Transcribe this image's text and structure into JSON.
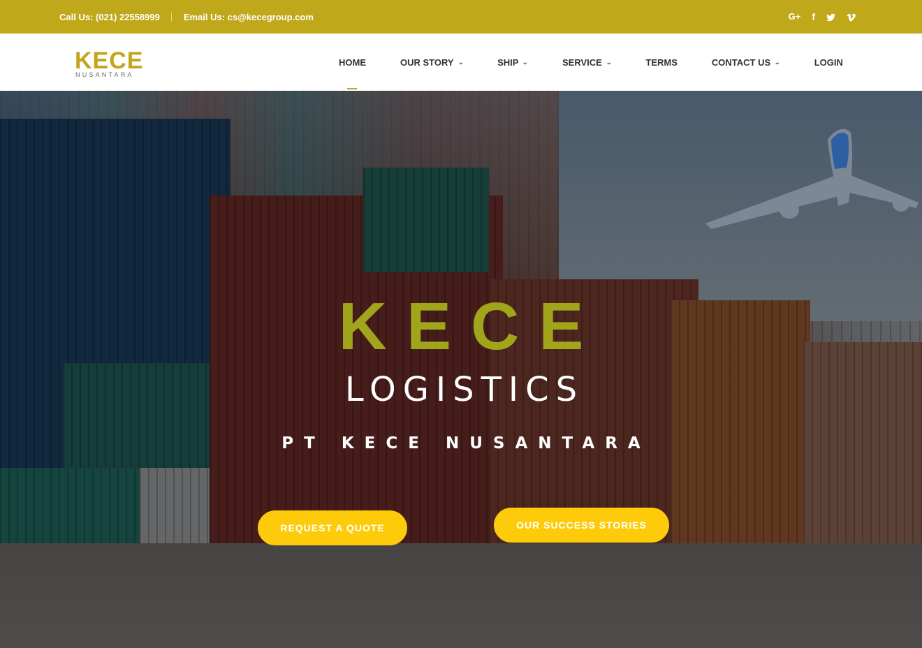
{
  "topbar": {
    "phone": "Call Us: (021) 22558999",
    "email": "Email Us: cs@kecegroup.com",
    "social": [
      {
        "icon": "google-plus-icon",
        "glyph": "G+"
      },
      {
        "icon": "facebook-icon",
        "glyph": "f"
      },
      {
        "icon": "twitter-icon",
        "glyph": "t"
      },
      {
        "icon": "vimeo-icon",
        "glyph": "v"
      }
    ]
  },
  "logo": {
    "main": "KECE",
    "sub": "NUSANTARA"
  },
  "nav": {
    "items": [
      {
        "label": "HOME",
        "active": true,
        "dropdown": false
      },
      {
        "label": "OUR STORY",
        "active": false,
        "dropdown": true
      },
      {
        "label": "SHIP",
        "active": false,
        "dropdown": true
      },
      {
        "label": "SERVICE",
        "active": false,
        "dropdown": true
      },
      {
        "label": "TERMS",
        "active": false,
        "dropdown": false
      },
      {
        "label": "CONTACT US",
        "active": false,
        "dropdown": true
      },
      {
        "label": "LOGIN",
        "active": false,
        "dropdown": false
      }
    ],
    "dropdown_glyph": "⌄"
  },
  "hero": {
    "title": "KECE",
    "subtitle": "LOGISTICS",
    "company": "PT KECE NUSANTARA",
    "buttons": {
      "quote": "REQUEST A QUOTE",
      "stories": "OUR SUCCESS STORIES"
    }
  },
  "colors": {
    "brand_gold": "#bfa819",
    "title_olive": "#a1a51c",
    "button_yellow": "#fecb0a"
  }
}
